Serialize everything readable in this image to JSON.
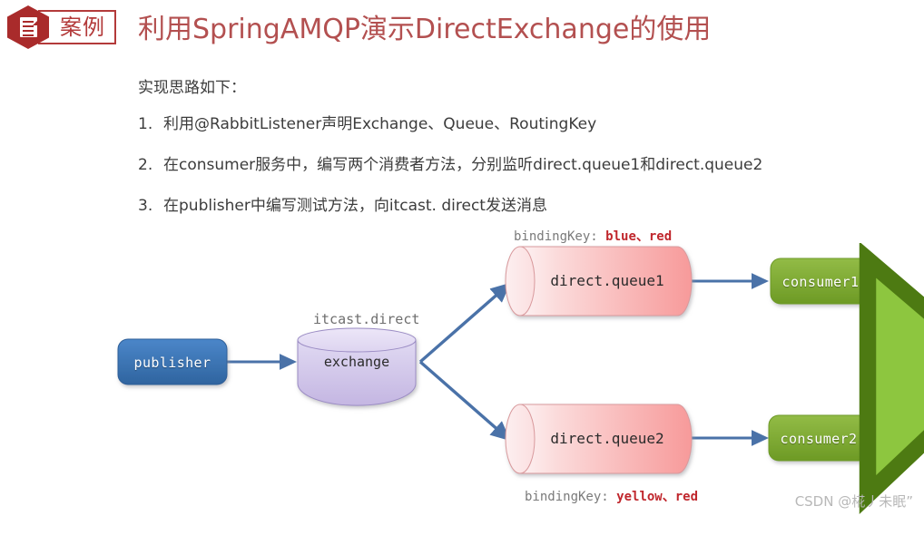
{
  "header": {
    "badge_icon": "document-hexagon-icon",
    "badge_label": "案例",
    "title": "利用SpringAMQP演示DirectExchange的使用",
    "title_color": "#b35050",
    "badge_color": "#b33a3a"
  },
  "content": {
    "intro": "实现思路如下：",
    "steps": [
      {
        "num": "1.",
        "text": "利用@RabbitListener声明Exchange、Queue、RoutingKey"
      },
      {
        "num": "2.",
        "text": "在consumer服务中，编写两个消费者方法，分别监听direct.queue1和direct.queue2"
      },
      {
        "num": "3.",
        "text": "在publisher中编写测试方法，向itcast. direct发送消息"
      }
    ]
  },
  "diagram": {
    "publisher": {
      "label": "publisher",
      "color": "#3d75b8"
    },
    "exchange": {
      "label": "exchange",
      "caption": "itcast.direct",
      "color": "#cdc2e8"
    },
    "queues": [
      {
        "label": "direct.queue1",
        "color": "#f6a8a8"
      },
      {
        "label": "direct.queue2",
        "color": "#f6a8a8"
      }
    ],
    "consumers": [
      {
        "label": "consumer1",
        "color": "#7aa832"
      },
      {
        "label": "consumer2",
        "color": "#7aa832"
      }
    ],
    "bindings": [
      {
        "prefix": "bindingKey: ",
        "keys": "blue、red"
      },
      {
        "prefix": "bindingKey: ",
        "keys": "yellow、red"
      }
    ],
    "arrow_color": "#4a72a8",
    "key_color": "#c0272d"
  },
  "watermark": "CSDN @椛丿未眠”"
}
